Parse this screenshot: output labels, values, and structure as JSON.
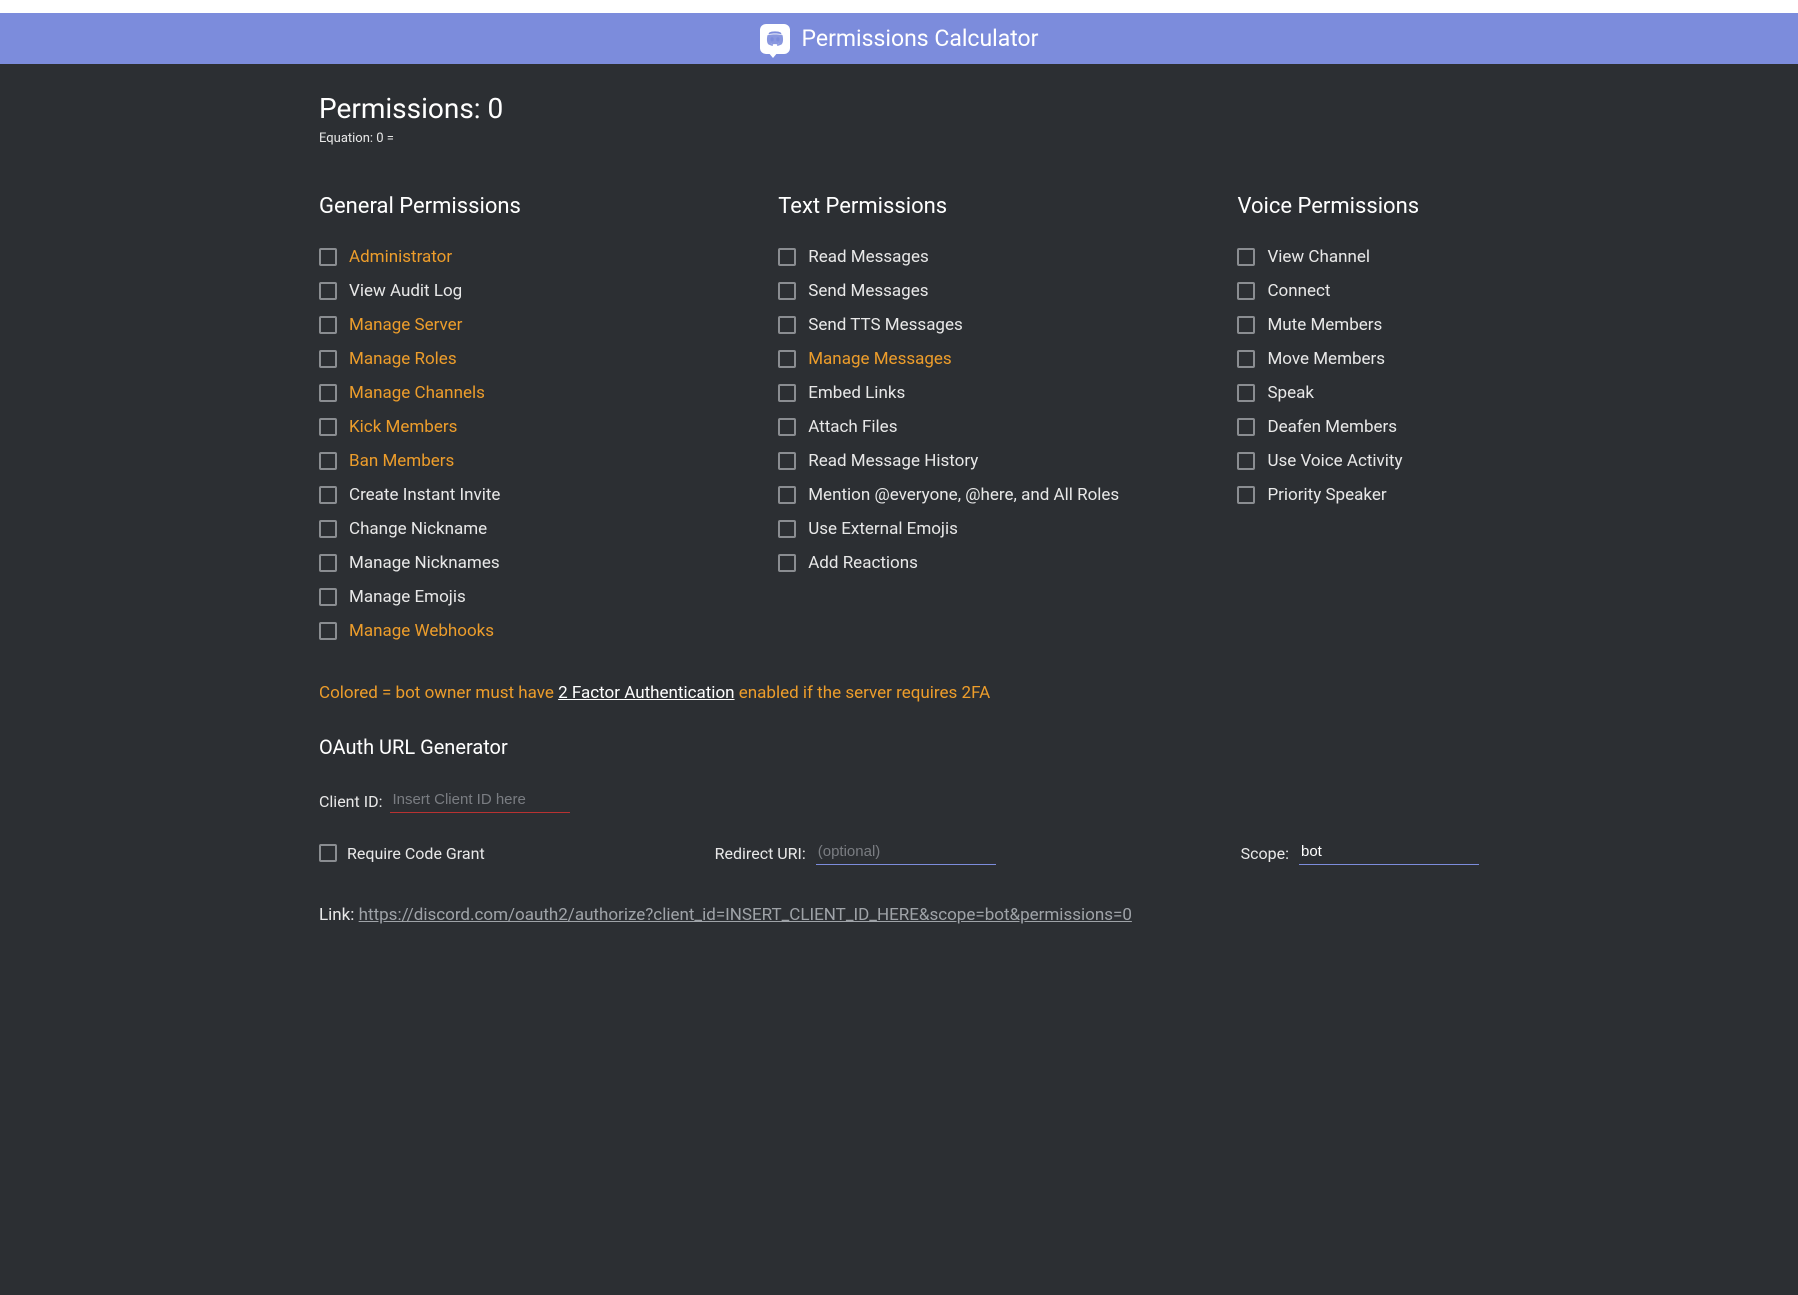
{
  "header": {
    "title": "Permissions Calculator"
  },
  "permissions_title_prefix": "Permissions: ",
  "permissions_value": "0",
  "equation_prefix": "Equation: ",
  "equation_value": "0  =",
  "columns": {
    "general": {
      "heading": "General Permissions",
      "items": [
        {
          "label": "Administrator",
          "colored": true
        },
        {
          "label": "View Audit Log",
          "colored": false
        },
        {
          "label": "Manage Server",
          "colored": true
        },
        {
          "label": "Manage Roles",
          "colored": true
        },
        {
          "label": "Manage Channels",
          "colored": true
        },
        {
          "label": "Kick Members",
          "colored": true
        },
        {
          "label": "Ban Members",
          "colored": true
        },
        {
          "label": "Create Instant Invite",
          "colored": false
        },
        {
          "label": "Change Nickname",
          "colored": false
        },
        {
          "label": "Manage Nicknames",
          "colored": false
        },
        {
          "label": "Manage Emojis",
          "colored": false
        },
        {
          "label": "Manage Webhooks",
          "colored": true
        }
      ]
    },
    "text": {
      "heading": "Text Permissions",
      "items": [
        {
          "label": "Read Messages",
          "colored": false
        },
        {
          "label": "Send Messages",
          "colored": false
        },
        {
          "label": "Send TTS Messages",
          "colored": false
        },
        {
          "label": "Manage Messages",
          "colored": true
        },
        {
          "label": "Embed Links",
          "colored": false
        },
        {
          "label": "Attach Files",
          "colored": false
        },
        {
          "label": "Read Message History",
          "colored": false
        },
        {
          "label": "Mention @everyone, @here, and All Roles",
          "colored": false
        },
        {
          "label": "Use External Emojis",
          "colored": false
        },
        {
          "label": "Add Reactions",
          "colored": false
        }
      ]
    },
    "voice": {
      "heading": "Voice Permissions",
      "items": [
        {
          "label": "View Channel",
          "colored": false
        },
        {
          "label": "Connect",
          "colored": false
        },
        {
          "label": "Mute Members",
          "colored": false
        },
        {
          "label": "Move Members",
          "colored": false
        },
        {
          "label": "Speak",
          "colored": false
        },
        {
          "label": "Deafen Members",
          "colored": false
        },
        {
          "label": "Use Voice Activity",
          "colored": false
        },
        {
          "label": "Priority Speaker",
          "colored": false
        }
      ]
    }
  },
  "note": {
    "prefix": "Colored = bot owner must have ",
    "link_text": "2 Factor Authentication",
    "suffix": " enabled if the server requires 2FA"
  },
  "oauth": {
    "heading": "OAuth URL Generator",
    "client_id_label": "Client ID:",
    "client_id_placeholder": "Insert Client ID here",
    "require_code_grant": "Require Code Grant",
    "redirect_label": "Redirect URI:",
    "redirect_placeholder": "(optional)",
    "scope_label": "Scope:",
    "scope_value": "bot",
    "link_label": "Link: ",
    "link_url": "https://discord.com/oauth2/authorize?client_id=INSERT_CLIENT_ID_HERE&scope=bot&permissions=0"
  }
}
